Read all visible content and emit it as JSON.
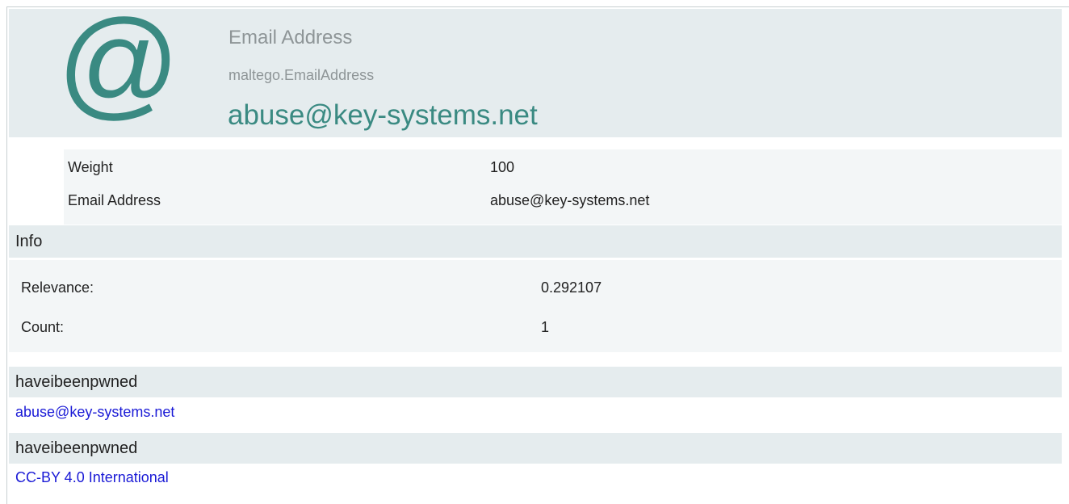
{
  "entity": {
    "type_name": "Email Address",
    "type_id": "maltego.EmailAddress",
    "value": "abuse@key-systems.net",
    "icon": "at-sign-icon"
  },
  "properties": [
    {
      "key": "Weight",
      "value": "100"
    },
    {
      "key": "Email Address",
      "value": "abuse@key-systems.net"
    }
  ],
  "info": {
    "title": "Info",
    "rows": [
      {
        "key": "Relevance:",
        "value": "0.292107"
      },
      {
        "key": "Count:",
        "value": "1"
      }
    ]
  },
  "sources": [
    {
      "title": "haveibeenpwned",
      "link_text": "abuse@key-systems.net"
    },
    {
      "title": "haveibeenpwned",
      "link_text": "CC-BY 4.0 International"
    }
  ],
  "colors": {
    "header_bg": "#e5ecee",
    "accent": "#3a8a82",
    "muted_text": "#8e9597",
    "link": "#1a1ad6"
  }
}
